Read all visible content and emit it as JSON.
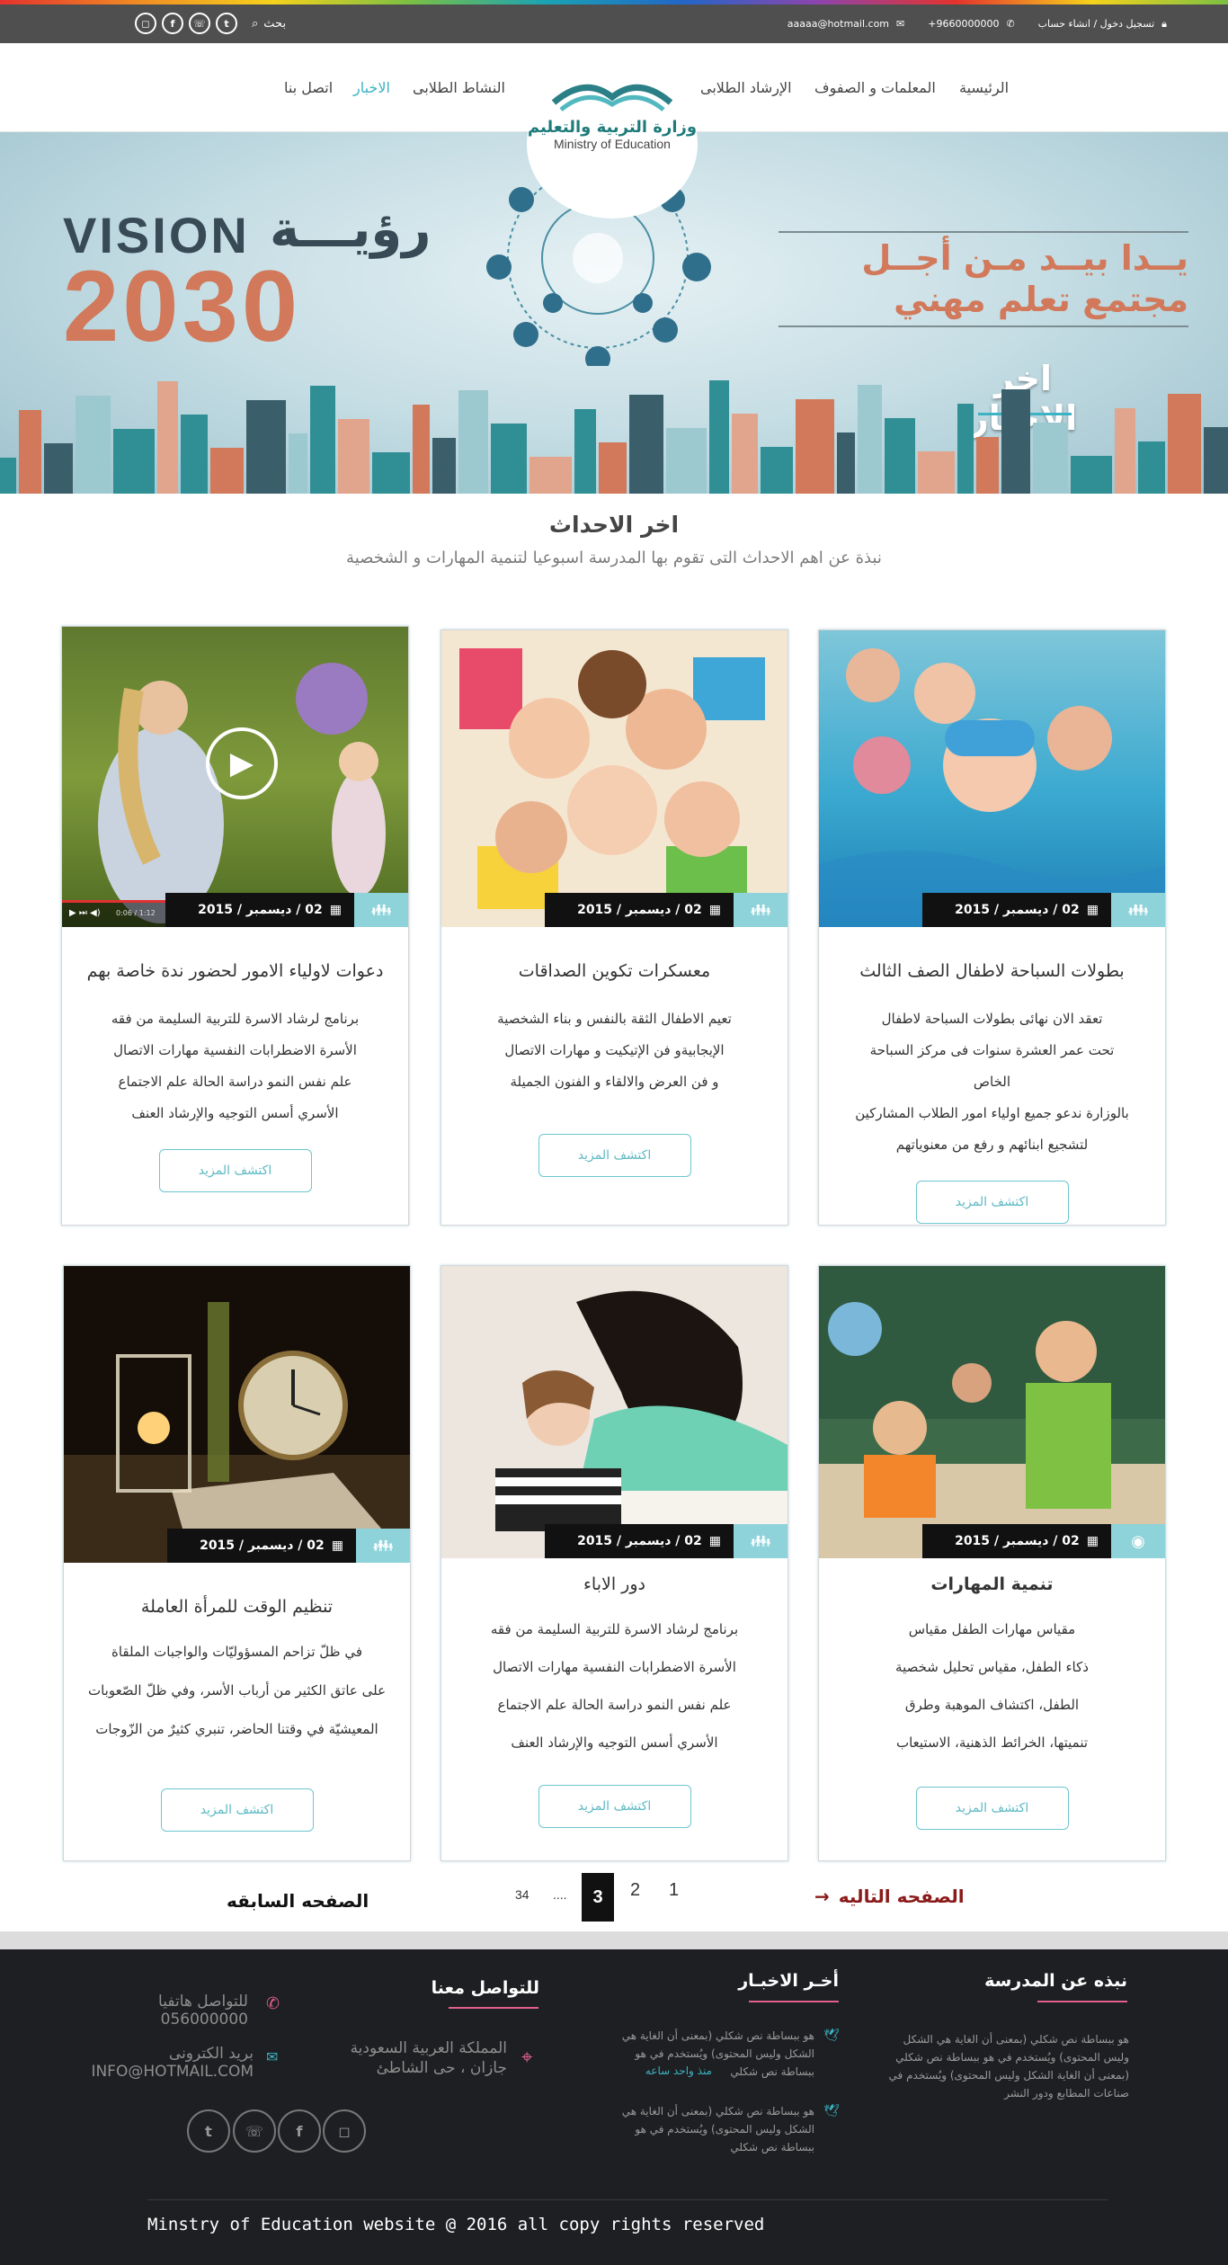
{
  "topbar": {
    "search_label": "بحث",
    "social": [
      "twitter-icon",
      "whatsapp-icon",
      "facebook-icon",
      "instagram-icon"
    ],
    "email": "aaaaa@hotmail.com",
    "phone": "+9660000000",
    "login": "تسجيل دخول / انشاء حساب"
  },
  "nav": {
    "items": [
      "الرئيسية",
      "المعلمات و الصفوف",
      "الإرشاد الطلابى",
      "النشاط الطلابى",
      "الاخبار",
      "اتصل بنا"
    ],
    "active_index": 4,
    "logo_ar": "وزارة التربية والتعليم",
    "logo_en": "Ministry of Education"
  },
  "hero": {
    "vision_en": "VISION",
    "vision_ar": "رؤيـــة",
    "year": "2030",
    "slogan_line1": "يــدا بيــد مـن أجــل",
    "slogan_line2": "مجتمع تعلم مهني",
    "title": "اخر الاخبار"
  },
  "section": {
    "title": "اخر الاحداث",
    "subtitle": "نبذة عن اهم الاحداث التى تقوم بها المدرسة اسبوعيا لتنمية المهارات و الشخصية"
  },
  "cards": [
    {
      "title": "بطولات السباحة لاطفال الصف الثالث",
      "date": "02 / ديسمبر / 2015",
      "lines": [
        "تعقد الان نهائى بطولات السباحة لاطفال",
        "تحت عمر العشرة سنوات فى مركز السباحة  الخاص",
        "بالوزارة ندعو جميع اولياء امور الطلاب المشاركين",
        "لتشجيع ابنائهم و رفع من معنوياتهم"
      ],
      "button": "اكتشف المزيد",
      "type_icon": "group-icon"
    },
    {
      "title": "معسكرات تكوين الصداقات",
      "date": "02 / ديسمبر / 2015",
      "lines": [
        "تعيم الاطفال الثقة بالنفس و بناء الشخصية",
        "الإيجابيةو فن الإتيكيت و مهارات الاتصال",
        "و فن العرض والالقاء و الفنون الجميلة"
      ],
      "button": "اكتشف المزيد",
      "type_icon": "group-icon"
    },
    {
      "title": "دعوات لاولياء الامور لحضور ندة خاصة بهم",
      "date": "02 / ديسمبر / 2015",
      "lines": [
        "برنامج لرشاد الاسرة للتربية السليمة من فقه",
        "الأسرة الاضطرابات النفسية مهارات الاتصال",
        "علم نفس النمو دراسة الحالة علم الاجتماع",
        "الأسري أسس التوجيه والإرشاد العنف"
      ],
      "button": "اكتشف المزيد",
      "type_icon": "group-icon",
      "video_time": "0:06 / 1:12"
    },
    {
      "title": "تنمية المهارات",
      "date": "02 / ديسمبر / 2015",
      "lines": [
        "مقياس مهارات الطفل مقياس",
        "ذكاء الطفل، مقياس تحليل شخصية",
        "الطفل، اكتشاف الموهبة وطرق",
        "تنميتها، الخرائط الذهنية، الاستيعاب"
      ],
      "button": "اكتشف المزيد",
      "type_icon": "camera-icon"
    },
    {
      "title": "دور الاباء",
      "date": "02 / ديسمبر / 2015",
      "lines": [
        "برنامج لرشاد الاسرة للتربية السليمة من فقه",
        "الأسرة الاضطرابات النفسية مهارات الاتصال",
        "علم نفس النمو دراسة الحالة علم الاجتماع",
        "الأسري أسس التوجيه والإرشاد العنف"
      ],
      "button": "اكتشف المزيد",
      "type_icon": "group-icon"
    },
    {
      "title": "تنظيم الوقت للمرأة العاملة",
      "date": "02 / ديسمبر / 2015",
      "lines": [
        "في ظلّ تزاحم المسؤوليّات والواجبات الملقاة",
        "على عاتق الكثير من أرباب الأسر، وفي ظلّ الصّعوبات",
        "المعيشيّة في وقتنا الحاضر، تنبري كثيرٌ من الزّوجات"
      ],
      "button": "اكتشف المزيد",
      "type_icon": "group-icon"
    }
  ],
  "pagination": {
    "next": "الصفحه التاليه",
    "prev": "الصفحه السابقه",
    "pages": [
      "1",
      "2",
      "3",
      "....",
      "34"
    ],
    "current": "3"
  },
  "footer": {
    "about_title": "نبذه عن المدرسة",
    "about_text": "هو ببساطة نص شكلي (بمعنى أن الغاية هي الشكل وليس المحتوى) ويُستخدم في هو ببساطة نص شكلي (بمعنى أن الغاية الشكل وليس المحتوى) ويُستخدم في صناعات المطابع ودور النشر",
    "news_title": "أخـر الاخبـار",
    "news1": "هو ببساطة نص شكلي (بمعنى أن الغاية هي الشكل وليس المحتوى) ويُستخدم في هو ببساطة نص شكلي",
    "news1_time": "منذ واحد ساعه",
    "news2": "هو ببساطة نص شكلي (بمعنى أن الغاية هي الشكل وليس المحتوى) ويُستخدم في هو ببساطة نص شكلي",
    "contact_title": "للتواصل معنا",
    "country": "المملكة العربية السعودية",
    "city": "جازان  ،  حى الشاطئ",
    "phone_label": "للتواصل هاتفيا",
    "phone": "056000000",
    "email_label": "بريد الكترونى",
    "email": "INFO@HOTMAIL.COM",
    "copyright": "Minstry of Education website @ 2016  all copy rights reserved"
  },
  "colors": {
    "accent": "#3bb3c3",
    "slogan": "#d1795a",
    "next": "#8b1a1a",
    "footer_line": "#e0608a"
  }
}
